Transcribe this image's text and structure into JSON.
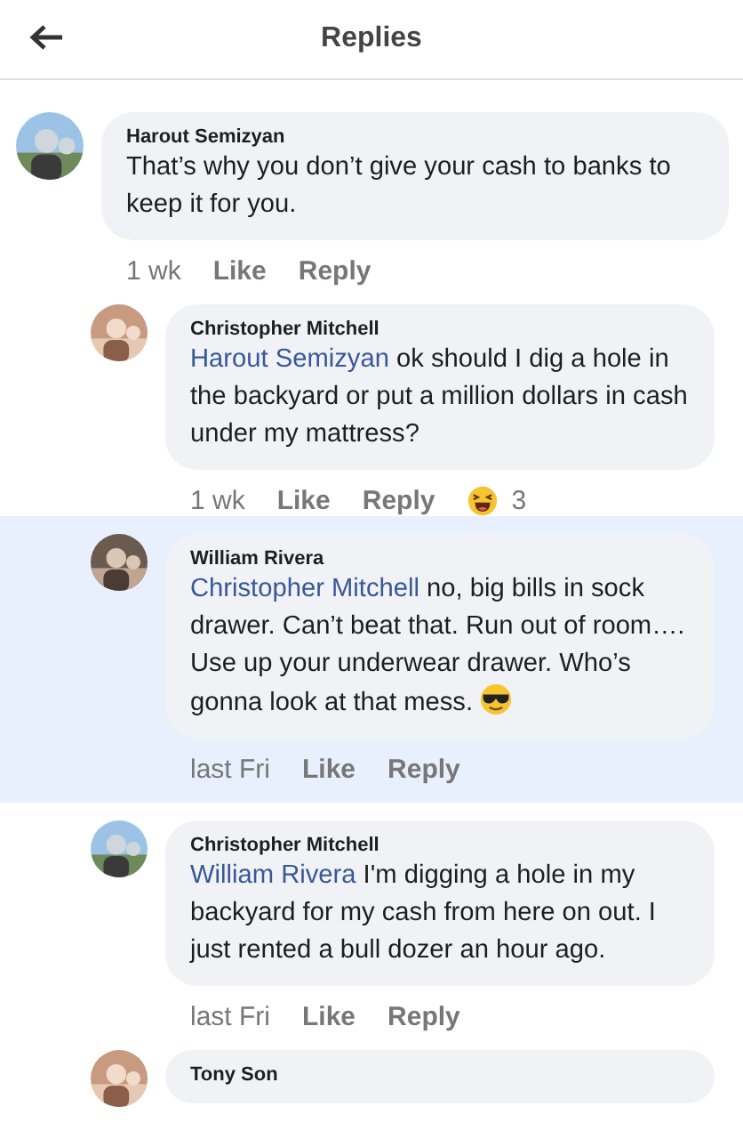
{
  "header": {
    "title": "Replies"
  },
  "comments": [
    {
      "author": "Harout Semizyan",
      "text": "That’s why you don’t give your cash to banks to keep it for you.",
      "time": "1 wk",
      "actions": [
        "Like",
        "Reply"
      ],
      "highlighted": false,
      "children": [
        {
          "author": "Christopher Mitchell",
          "mention": "Harout Semizyan",
          "text": "ok should I dig a hole in the backyard or put a million dollars in cash under my mattress?",
          "time": "1 wk",
          "actions": [
            "Like",
            "Reply"
          ],
          "highlighted": false,
          "reaction": {
            "count": "3"
          }
        },
        {
          "author": "William Rivera",
          "mention": "Christopher Mitchell",
          "text": "no, big bills in sock drawer. Can’t beat that. Run out of room…. Use up your underwear drawer. Who’s gonna look at that mess.",
          "has_emoji": true,
          "time": "last Fri",
          "actions": [
            "Like",
            "Reply"
          ],
          "highlighted": true
        },
        {
          "author": "Christopher Mitchell",
          "mention": "William Rivera",
          "text": "I'm digging a hole in my backyard for my cash from here on out. I just rented a bull dozer an hour ago.",
          "time": "last Fri",
          "actions": [
            "Like",
            "Reply"
          ],
          "highlighted": false
        },
        {
          "author": "Tony Son",
          "highlighted": false
        }
      ]
    }
  ]
}
